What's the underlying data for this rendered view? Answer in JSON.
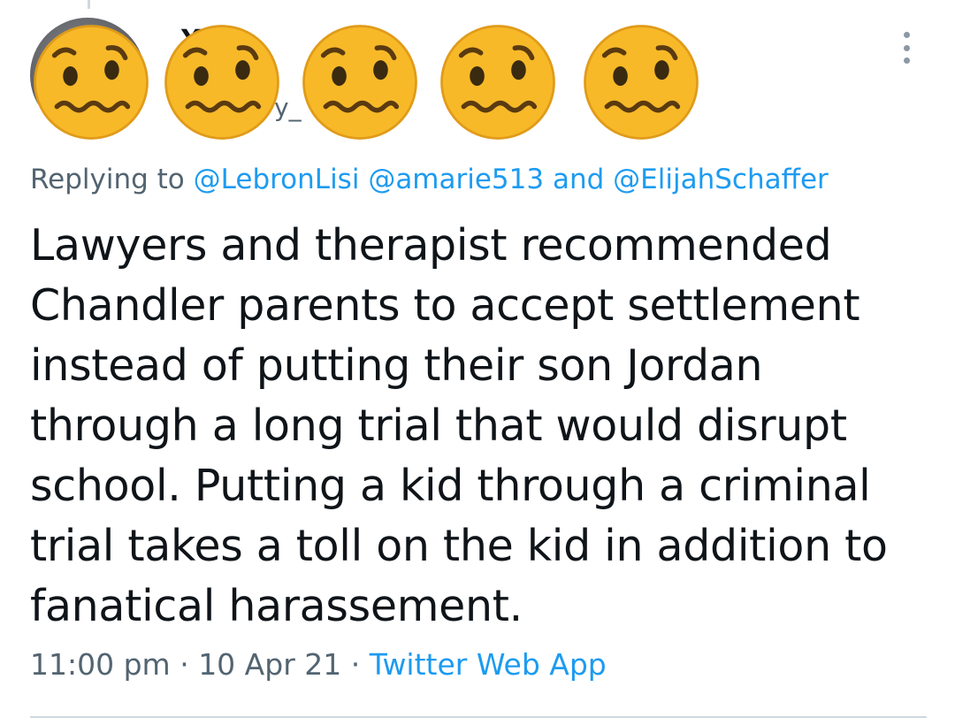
{
  "tweet": {
    "display_name": "Y",
    "handle_fragment": "y_",
    "replying_prefix": "Replying to",
    "mentions": [
      "@LebronLisi",
      "@amarie513",
      "@ElijahSchaffer"
    ],
    "mention_separator": "and",
    "text_lines": [
      "Lawyers and therapist recommended",
      "Chandler parents to accept settlement",
      "instead of putting their son Jordan",
      "through a long trial that would disrupt",
      "school. Putting a kid through a criminal",
      "trial takes a toll on the kid in addition to",
      "fanatical harassement."
    ],
    "time": "11:00 pm",
    "date": "10 Apr 21",
    "source": "Twitter Web App",
    "meta_separator": "·"
  },
  "overlay": {
    "emoji_icon": "woozy-face-emoji-icon",
    "emoji_count": 5
  },
  "colors": {
    "text": "#0f1419",
    "secondary": "#536471",
    "link": "#1d9bf0",
    "emoji_face": "#f7b928",
    "divider": "#cfd9de"
  }
}
